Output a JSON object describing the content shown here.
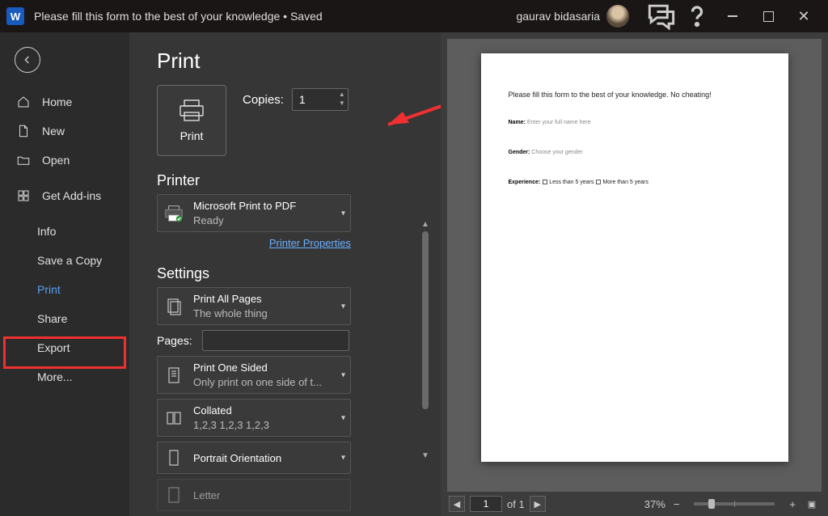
{
  "titlebar": {
    "app_logo_letter": "W",
    "doc_title": "Please fill this form to the best of your knowledge",
    "save_status": "Saved",
    "username": "gaurav bidasaria"
  },
  "sidebar": {
    "items": [
      {
        "label": "Home",
        "icon": "home"
      },
      {
        "label": "New",
        "icon": "file"
      },
      {
        "label": "Open",
        "icon": "folder"
      }
    ],
    "addins_label": "Get Add-ins",
    "sub_items": [
      {
        "label": "Info"
      },
      {
        "label": "Save a Copy"
      },
      {
        "label": "Print",
        "active": true
      },
      {
        "label": "Share"
      },
      {
        "label": "Export"
      },
      {
        "label": "More..."
      }
    ]
  },
  "print": {
    "page_title": "Print",
    "print_button_label": "Print",
    "copies_label": "Copies:",
    "copies_value": "1",
    "printer_heading": "Printer",
    "printer_name": "Microsoft Print to PDF",
    "printer_status": "Ready",
    "printer_properties_link": "Printer Properties",
    "settings_heading": "Settings",
    "settings": {
      "pages_scope": {
        "title": "Print All Pages",
        "sub": "The whole thing"
      },
      "pages_label": "Pages:",
      "pages_value": "",
      "sided": {
        "title": "Print One Sided",
        "sub": "Only print on one side of t..."
      },
      "collated": {
        "title": "Collated",
        "sub": "1,2,3    1,2,3    1,2,3"
      },
      "orientation": {
        "title": "Portrait Orientation"
      },
      "paper": {
        "title": "Letter"
      }
    }
  },
  "preview": {
    "heading": "Please fill this form to the best of your knowledge. No cheating!",
    "fields": {
      "name_label": "Name:",
      "name_hint": "Enter your full name here",
      "gender_label": "Gender:",
      "gender_hint": "Choose your gender",
      "exp_label": "Experience:",
      "exp_opt1": "Less than 5 years",
      "exp_opt2": "More than 5 years"
    },
    "footer": {
      "current_page": "1",
      "page_of_label": "of 1",
      "zoom_label": "37%"
    }
  }
}
